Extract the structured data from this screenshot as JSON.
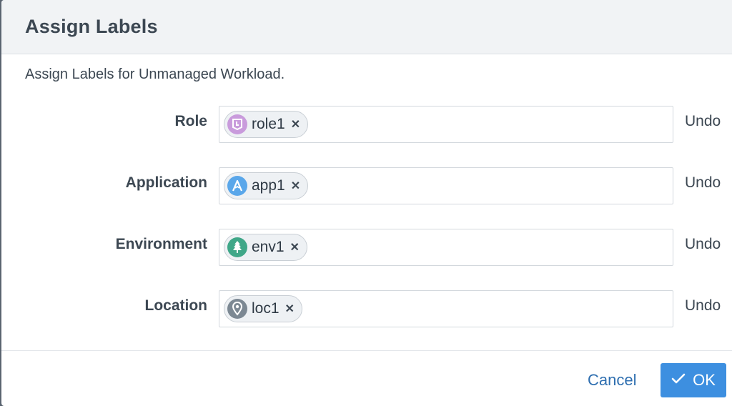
{
  "dialog": {
    "title": "Assign Labels",
    "subtitle": "Assign Labels for Unmanaged Workload."
  },
  "rows": [
    {
      "label": "Role",
      "chip": "role1",
      "icon": "role-icon",
      "icon_color": "#c99bdc",
      "undo": "Undo"
    },
    {
      "label": "Application",
      "chip": "app1",
      "icon": "application-icon",
      "icon_color": "#5aa7ea",
      "undo": "Undo"
    },
    {
      "label": "Environment",
      "chip": "env1",
      "icon": "tree-icon",
      "icon_color": "#3fa788",
      "undo": "Undo"
    },
    {
      "label": "Location",
      "chip": "loc1",
      "icon": "location-pin-icon",
      "icon_color": "#7c8893",
      "undo": "Undo"
    }
  ],
  "footer": {
    "cancel_label": "Cancel",
    "ok_label": "OK",
    "ok_color": "#3d8fe0"
  }
}
